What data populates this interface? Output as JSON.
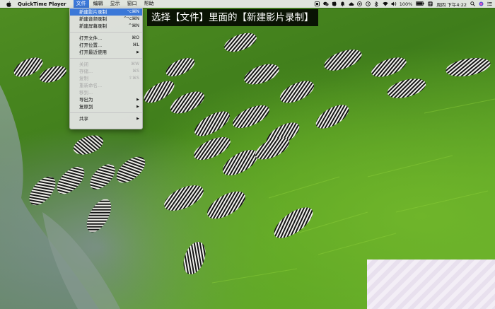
{
  "menubar": {
    "app_name": "QuickTime Player",
    "menus": [
      "文件",
      "编辑",
      "显示",
      "窗口",
      "帮助"
    ],
    "active_menu_index": 0,
    "battery": "100%",
    "clock": "周四 下午4:22"
  },
  "file_menu": {
    "items": [
      {
        "label": "新建影片录制",
        "shortcut": "⌥⌘N",
        "state": "highlight"
      },
      {
        "label": "新建音频录制",
        "shortcut": "^⌥⌘N",
        "state": "normal"
      },
      {
        "label": "新建屏幕录制",
        "shortcut": "^⌘N",
        "state": "normal"
      },
      {
        "sep": true
      },
      {
        "label": "打开文件...",
        "shortcut": "⌘O",
        "state": "normal"
      },
      {
        "label": "打开位置...",
        "shortcut": "⌘L",
        "state": "normal"
      },
      {
        "label": "打开最近使用",
        "shortcut": "▶",
        "state": "normal"
      },
      {
        "sep": true
      },
      {
        "label": "关闭",
        "shortcut": "⌘W",
        "state": "disabled"
      },
      {
        "label": "存储...",
        "shortcut": "⌘S",
        "state": "disabled"
      },
      {
        "label": "复制",
        "shortcut": "⇧⌘S",
        "state": "disabled"
      },
      {
        "label": "重新命名...",
        "shortcut": "",
        "state": "disabled"
      },
      {
        "label": "移到...",
        "shortcut": "",
        "state": "disabled"
      },
      {
        "label": "导出为",
        "shortcut": "▶",
        "state": "normal"
      },
      {
        "label": "复原到",
        "shortcut": "▶",
        "state": "normal"
      },
      {
        "sep": true
      },
      {
        "label": "共享",
        "shortcut": "▶",
        "state": "normal"
      }
    ]
  },
  "caption": {
    "text": "选择【文件】里面的【新建影片录制】"
  },
  "colors": {
    "highlight": "#3b78d8",
    "menubar_bg": "#ececec",
    "caption_bg": "#000000"
  }
}
